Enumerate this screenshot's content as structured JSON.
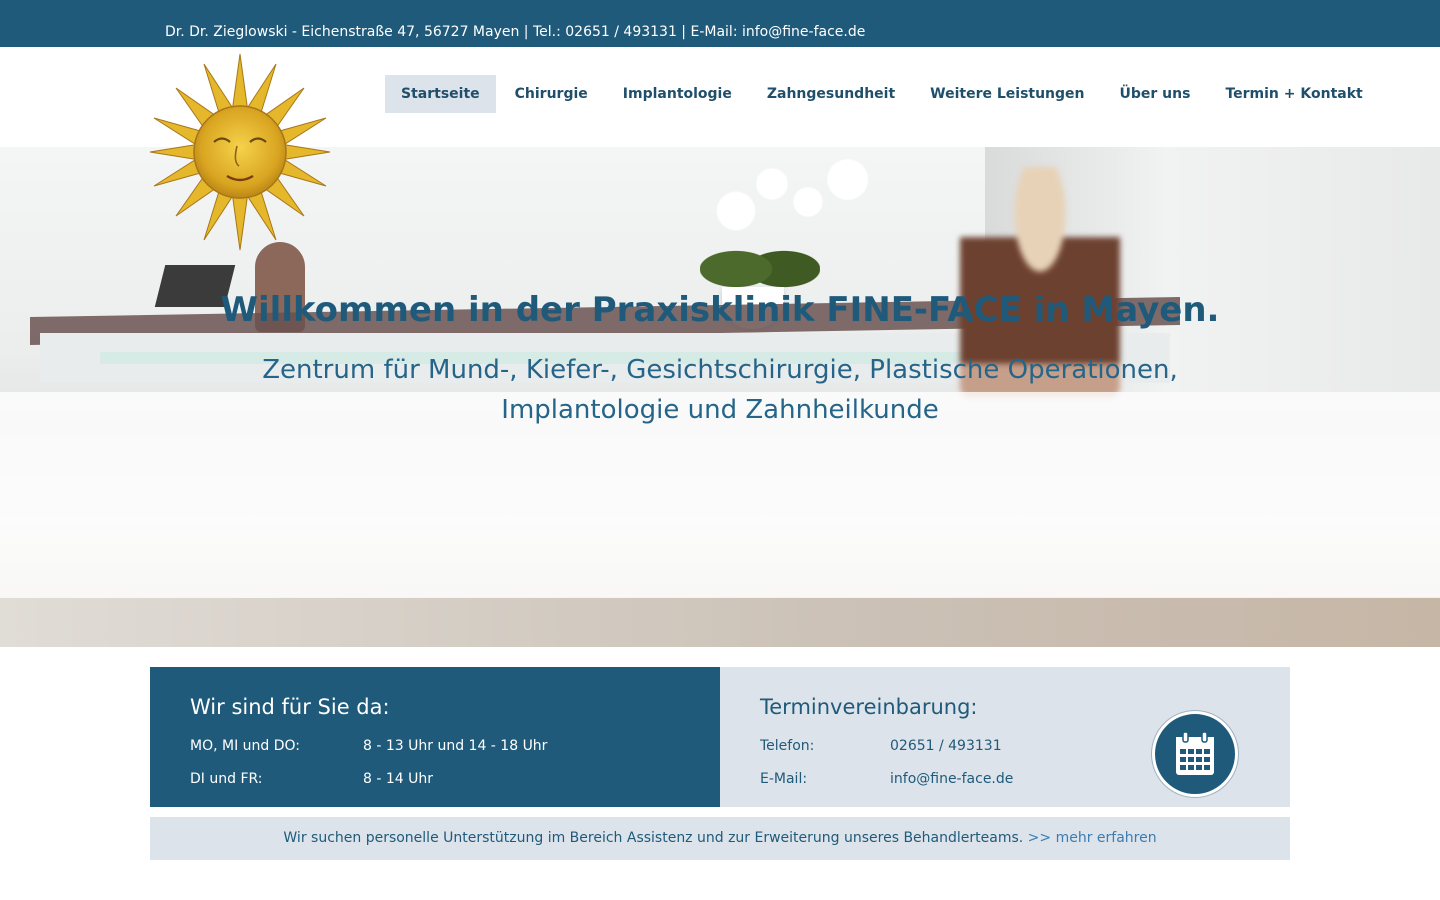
{
  "topbar": {
    "contact_line": "Dr. Dr. Zieglowski - Eichenstraße 47, 56727 Mayen | Tel.: 02651 / 493131 | E-Mail: info@fine-face.de"
  },
  "nav": {
    "items": [
      {
        "label": "Startseite",
        "active": true
      },
      {
        "label": "Chirurgie"
      },
      {
        "label": "Implantologie"
      },
      {
        "label": "Zahngesundheit"
      },
      {
        "label": "Weitere Leistungen"
      },
      {
        "label": "Über uns"
      },
      {
        "label": "Termin + Kontakt"
      }
    ]
  },
  "hero": {
    "title": "Willkommen in der Praxisklinik FINE-FACE in Mayen.",
    "subtitle": "Zentrum für Mund-, Kiefer-, Gesichtschirurgie, Plastische Operationen, Implantologie und Zahnheilkunde"
  },
  "hours": {
    "heading": "Wir sind für Sie da:",
    "rows": [
      {
        "label": "MO, MI und DO:",
        "value": "8 - 13 Uhr und 14 - 18 Uhr"
      },
      {
        "label": "DI und FR:",
        "value": "8 - 14 Uhr"
      }
    ]
  },
  "appointment": {
    "heading": "Terminvereinbarung:",
    "phone_label": "Telefon:",
    "phone_value": "02651 / 493131",
    "email_label": "E-Mail:",
    "email_value": "info@fine-face.de",
    "icon": "calendar-icon"
  },
  "notice": {
    "text": "Wir suchen personelle Unterstützung im Bereich Assistenz und zur Erweiterung unseres Behandlerteams.",
    "link": ">> mehr erfahren"
  },
  "colors": {
    "primary": "#1f5a7a",
    "light_panel": "#dde3ea",
    "link": "#3b7db2"
  }
}
